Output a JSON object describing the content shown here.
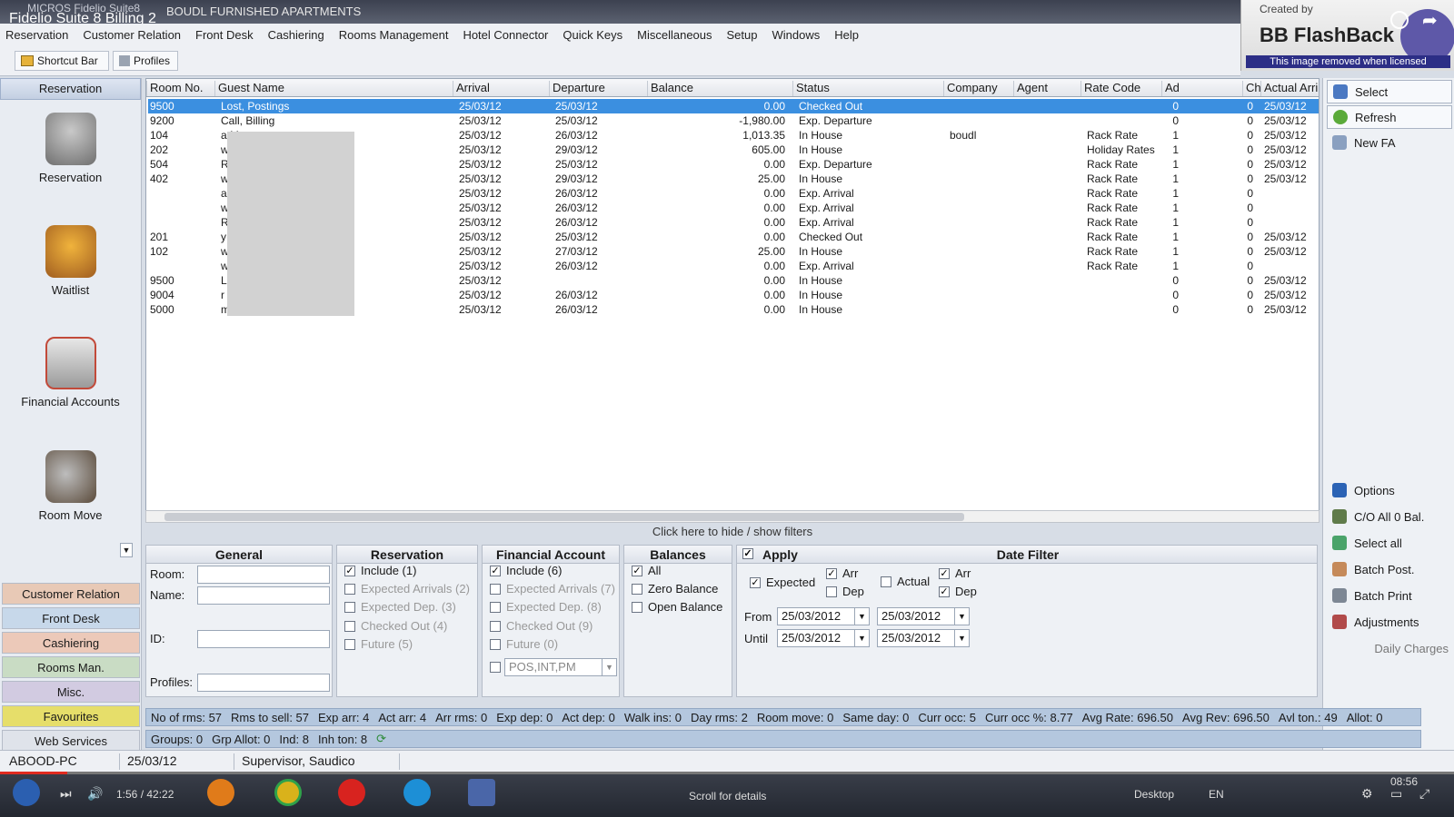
{
  "window": {
    "title": "Fidelio Suite 8 Billing 2",
    "app_name": "MICROS Fidelio Suite8",
    "property": "BOUDL FURNISHED APARTMENTS"
  },
  "menu": [
    "Reservation",
    "Customer Relation",
    "Front Desk",
    "Cashiering",
    "Rooms Management",
    "Hotel Connector",
    "Quick Keys",
    "Miscellaneous",
    "Setup",
    "Windows",
    "Help"
  ],
  "watermark": {
    "created_by": "Created by",
    "brand": "BB FlashBack",
    "notice": "This image removed when licensed"
  },
  "toolbar": {
    "shortcut_bar": "Shortcut Bar",
    "profiles": "Profiles"
  },
  "leftnav": {
    "header": "Reservation",
    "items": [
      "Reservation",
      "Waitlist",
      "Financial Accounts",
      "Room Move"
    ],
    "categories": [
      {
        "label": "Customer Relation",
        "color": "#e8c9b6"
      },
      {
        "label": "Front Desk",
        "color": "#c7d8ea"
      },
      {
        "label": "Cashiering",
        "color": "#ecc9b9"
      },
      {
        "label": "Rooms Man.",
        "color": "#c9dcc4"
      },
      {
        "label": "Misc.",
        "color": "#d2cbe1"
      },
      {
        "label": "Favourites",
        "color": "#e6de6a"
      },
      {
        "label": "Web Services",
        "color": "#dfe3ea"
      }
    ]
  },
  "grid": {
    "columns": [
      "Room No.",
      "Guest Name",
      "Arrival",
      "Departure",
      "Balance",
      "Status",
      "Company",
      "Agent",
      "Rate Code",
      "Ad",
      "Ch",
      "Actual Arri"
    ],
    "rows": [
      [
        "9500",
        "Lost, Postings",
        "25/03/12",
        "25/03/12",
        "0.00",
        "Checked Out",
        "",
        "",
        "",
        "0",
        "0",
        "25/03/12"
      ],
      [
        "9200",
        "Call, Billing",
        "25/03/12",
        "25/03/12",
        "-1,980.00",
        "Exp. Departure",
        "",
        "",
        "",
        "0",
        "0",
        "25/03/12"
      ],
      [
        "104",
        "a                             Mr.",
        "25/03/12",
        "26/03/12",
        "1,013.35",
        "In House",
        "boudl",
        "",
        "Rack Rate",
        "1",
        "0",
        "25/03/12"
      ],
      [
        "202",
        "w",
        "25/03/12",
        "29/03/12",
        "605.00",
        "In House",
        "",
        "",
        "Holiday Rates",
        "1",
        "0",
        "25/03/12"
      ],
      [
        "504",
        "R                             s",
        "25/03/12",
        "25/03/12",
        "0.00",
        "Exp. Departure",
        "",
        "",
        "Rack Rate",
        "1",
        "0",
        "25/03/12"
      ],
      [
        "402",
        "w",
        "25/03/12",
        "29/03/12",
        "25.00",
        "In House",
        "",
        "",
        "Rack Rate",
        "1",
        "0",
        "25/03/12"
      ],
      [
        "",
        "a                             Mr.",
        "25/03/12",
        "26/03/12",
        "0.00",
        "Exp. Arrival",
        "",
        "",
        "Rack Rate",
        "1",
        "0",
        ""
      ],
      [
        "",
        "w",
        "25/03/12",
        "26/03/12",
        "0.00",
        "Exp. Arrival",
        "",
        "",
        "Rack Rate",
        "1",
        "0",
        ""
      ],
      [
        "",
        "R                             s",
        "25/03/12",
        "26/03/12",
        "0.00",
        "Exp. Arrival",
        "",
        "",
        "Rack Rate",
        "1",
        "0",
        ""
      ],
      [
        "201",
        "y",
        "25/03/12",
        "25/03/12",
        "0.00",
        "Checked Out",
        "",
        "",
        "Rack Rate",
        "1",
        "0",
        "25/03/12"
      ],
      [
        "102",
        "w",
        "25/03/12",
        "27/03/12",
        "25.00",
        "In House",
        "",
        "",
        "Rack Rate",
        "1",
        "0",
        "25/03/12"
      ],
      [
        "",
        "w",
        "25/03/12",
        "26/03/12",
        "0.00",
        "Exp. Arrival",
        "",
        "",
        "Rack Rate",
        "1",
        "0",
        ""
      ],
      [
        "9500",
        "L",
        "25/03/12",
        "",
        "0.00",
        "In House",
        "",
        "",
        "",
        "0",
        "0",
        "25/03/12"
      ],
      [
        "9004",
        "r",
        "25/03/12",
        "26/03/12",
        "0.00",
        "In House",
        "",
        "",
        "",
        "0",
        "0",
        "25/03/12"
      ],
      [
        "5000",
        "m                             ed, Mr.",
        "25/03/12",
        "26/03/12",
        "0.00",
        "In House",
        "",
        "",
        "",
        "0",
        "0",
        "25/03/12"
      ]
    ]
  },
  "rightpanel": {
    "top": [
      "Select",
      "Refresh",
      "New FA"
    ],
    "bottom": [
      "Options",
      "C/O All 0 Bal.",
      "Select all",
      "Batch Post.",
      "Batch Print",
      "Adjustments",
      "Daily Charges"
    ]
  },
  "filters": {
    "hint": "Click here to hide / show filters",
    "general": {
      "title": "General",
      "room": "Room:",
      "name": "Name:",
      "id": "ID:",
      "profiles": "Profiles:"
    },
    "reservation": {
      "title": "Reservation",
      "items": [
        "Include (1)",
        "Expected Arrivals (2)",
        "Expected Dep. (3)",
        "Checked Out (4)",
        "Future (5)"
      ]
    },
    "financial": {
      "title": "Financial Account",
      "items": [
        "Include (6)",
        "Expected Arrivals (7)",
        "Expected Dep. (8)",
        "Checked Out (9)",
        "Future (0)"
      ],
      "select_value": "POS,INT,PM"
    },
    "balances": {
      "title": "Balances",
      "items": [
        "All",
        "Zero Balance",
        "Open Balance"
      ]
    },
    "date": {
      "apply": "Apply",
      "title": "Date Filter",
      "expected": "Expected",
      "actual": "Actual",
      "arr": "Arr",
      "dep": "Dep",
      "from": "From",
      "until": "Until",
      "from1": "25/03/2012",
      "from2": "25/03/2012",
      "until1": "25/03/2012",
      "until2": "25/03/2012"
    }
  },
  "stats1": [
    "No of rms:  57",
    "Rms to sell:  57",
    "Exp arr:  4",
    "Act arr:  4",
    "Arr rms:  0",
    "Exp dep:  0",
    "Act dep:  0",
    "Walk ins:  0",
    "Day rms:  2",
    "Room move:  0",
    "Same day:  0",
    "Curr occ:  5",
    "Curr occ %:  8.77",
    "Avg Rate:  696.50",
    "Avg Rev:  696.50",
    "Avl ton.:  49",
    "Allot:  0"
  ],
  "stats2": [
    "Groups:  0",
    "Grp Allot:  0",
    "Ind:  8",
    "Inh ton:  8"
  ],
  "statusbar": {
    "pc": "ABOOD-PC",
    "date": "25/03/12",
    "user": "Supervisor, Saudico"
  },
  "player": {
    "time": "1:56 / 42:22",
    "scroll": "Scroll for details",
    "desktop": "Desktop",
    "lang": "EN",
    "clock": "08:56",
    "progress": 0.046
  }
}
